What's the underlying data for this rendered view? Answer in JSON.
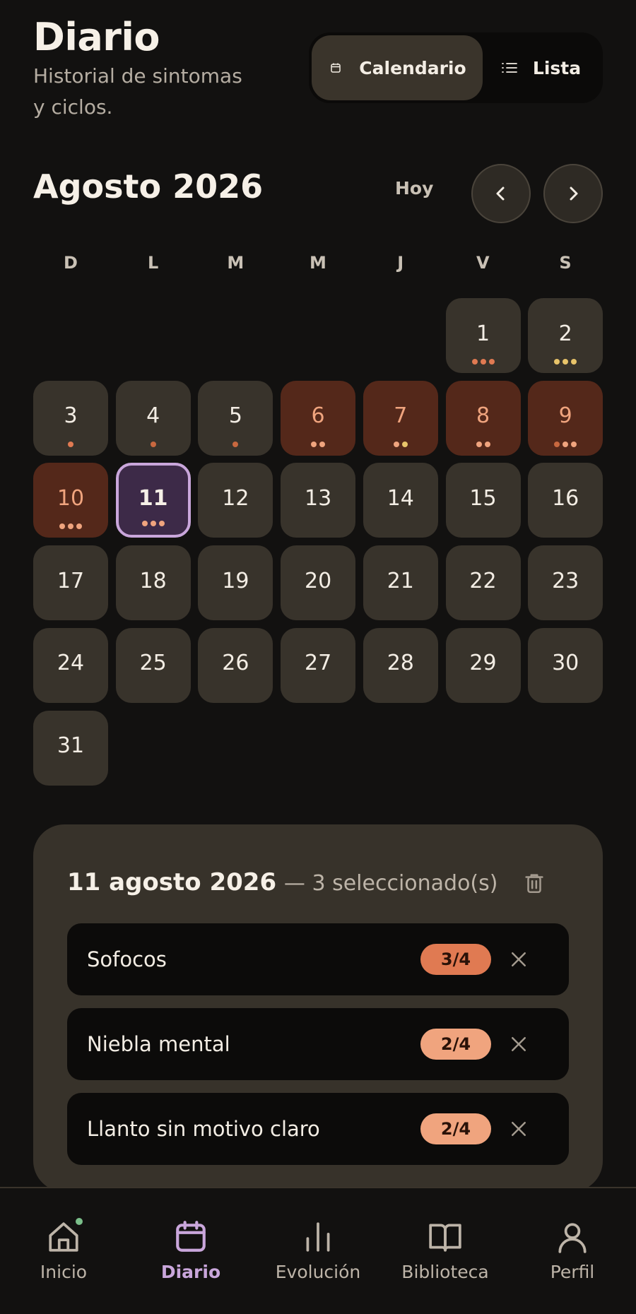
{
  "header": {
    "title": "Diario",
    "subtitle": "Historial de sintomas y ciclos."
  },
  "view_toggle": {
    "calendar_label": "Calendario",
    "list_label": "Lista",
    "active": "Calendario"
  },
  "calendar": {
    "month_title": "Agosto 2026",
    "today_label": "Hoy",
    "weekdays": [
      "D",
      "L",
      "M",
      "M",
      "J",
      "V",
      "S"
    ],
    "days": [
      {
        "day": "1",
        "type": "normal",
        "dots": [
          "#e07a52",
          "#e07a52",
          "#e07a52"
        ]
      },
      {
        "day": "2",
        "type": "normal",
        "dots": [
          "#e8c46a",
          "#e8c46a",
          "#e8c46a"
        ]
      },
      {
        "day": "3",
        "type": "normal",
        "dots": [
          "#e07a52"
        ]
      },
      {
        "day": "4",
        "type": "normal",
        "dots": [
          "#c8683f"
        ]
      },
      {
        "day": "5",
        "type": "normal",
        "dots": [
          "#c8683f"
        ]
      },
      {
        "day": "6",
        "type": "period",
        "dots": [
          "#f0a47e",
          "#f0a47e"
        ]
      },
      {
        "day": "7",
        "type": "period",
        "dots": [
          "#f0a47e",
          "#e8c46a"
        ]
      },
      {
        "day": "8",
        "type": "period",
        "dots": [
          "#f0a47e",
          "#f0a47e"
        ]
      },
      {
        "day": "9",
        "type": "period",
        "dots": [
          "#c8683f",
          "#f0a47e",
          "#f0a47e"
        ]
      },
      {
        "day": "10",
        "type": "period",
        "dots": [
          "#f0a47e",
          "#f0a47e",
          "#f0a47e"
        ]
      },
      {
        "day": "11",
        "type": "selected",
        "dots": [
          "#f0a47e",
          "#f0a47e",
          "#f0a47e"
        ]
      },
      {
        "day": "12",
        "type": "normal",
        "dots": []
      },
      {
        "day": "13",
        "type": "normal",
        "dots": []
      },
      {
        "day": "14",
        "type": "normal",
        "dots": []
      },
      {
        "day": "15",
        "type": "normal",
        "dots": []
      },
      {
        "day": "16",
        "type": "normal",
        "dots": []
      },
      {
        "day": "17",
        "type": "normal",
        "dots": []
      },
      {
        "day": "18",
        "type": "normal",
        "dots": []
      },
      {
        "day": "19",
        "type": "normal",
        "dots": []
      },
      {
        "day": "20",
        "type": "normal",
        "dots": []
      },
      {
        "day": "21",
        "type": "normal",
        "dots": []
      },
      {
        "day": "22",
        "type": "normal",
        "dots": []
      },
      {
        "day": "23",
        "type": "normal",
        "dots": []
      },
      {
        "day": "24",
        "type": "normal",
        "dots": []
      },
      {
        "day": "25",
        "type": "normal",
        "dots": []
      },
      {
        "day": "26",
        "type": "normal",
        "dots": []
      },
      {
        "day": "27",
        "type": "normal",
        "dots": []
      },
      {
        "day": "28",
        "type": "normal",
        "dots": []
      },
      {
        "day": "29",
        "type": "normal",
        "dots": []
      },
      {
        "day": "30",
        "type": "normal",
        "dots": []
      },
      {
        "day": "31",
        "type": "normal",
        "dots": []
      }
    ]
  },
  "detail": {
    "date": "11 agosto 2026",
    "count": "— 3 seleccionado(s)",
    "symptoms": [
      {
        "name": "Sofocos",
        "score": "3/4",
        "color": "#e07a52"
      },
      {
        "name": "Niebla mental",
        "score": "2/4",
        "color": "#f0a47e"
      },
      {
        "name": "Llanto sin motivo claro",
        "score": "2/4",
        "color": "#f0a47e"
      }
    ]
  },
  "tabs": [
    {
      "label": "Inicio",
      "icon": "home-icon"
    },
    {
      "label": "Diario",
      "icon": "calendar-icon"
    },
    {
      "label": "Evolución",
      "icon": "bar-chart-icon"
    },
    {
      "label": "Biblioteca",
      "icon": "book-icon"
    },
    {
      "label": "Perfil",
      "icon": "user-icon"
    }
  ],
  "colors": {
    "accent": "#c9a6db",
    "period_bg": "#54281a",
    "cell_bg": "#38332b",
    "notification": "#7bbf8a"
  }
}
